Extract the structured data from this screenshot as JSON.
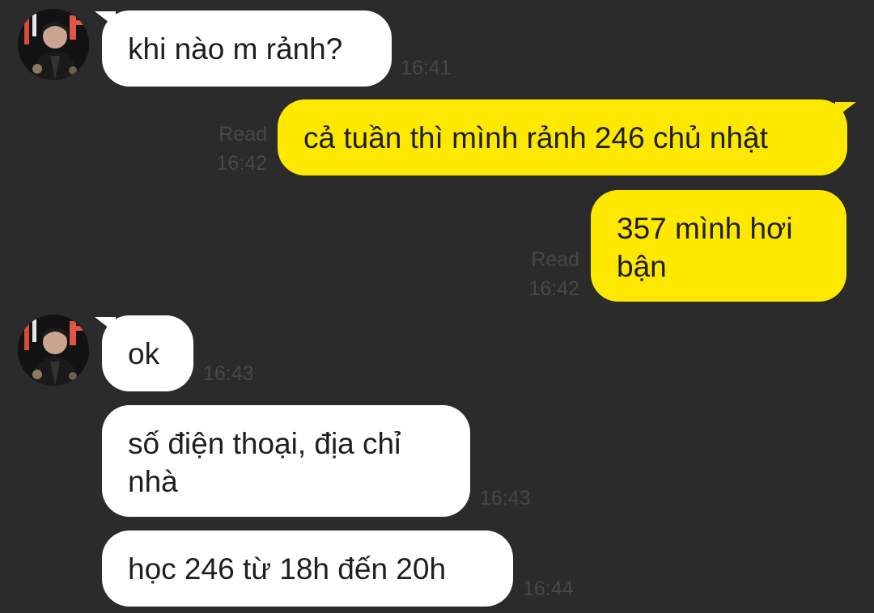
{
  "contact": {
    "avatar_icon": "contact-avatar-photo"
  },
  "messages": [
    {
      "direction": "incoming",
      "text": "khi nào m rảnh?",
      "time": "16:41"
    },
    {
      "direction": "outgoing",
      "text": "cả tuần thì mình rảnh 246 chủ nhật",
      "status": "Read",
      "time": "16:42"
    },
    {
      "direction": "outgoing",
      "text": "357 mình hơi bận",
      "status": "Read",
      "time": "16:42"
    },
    {
      "direction": "incoming",
      "text": "ok",
      "time": "16:43"
    },
    {
      "direction": "incoming",
      "text": "số điện thoại, địa chỉ nhà",
      "time": "16:43"
    },
    {
      "direction": "incoming",
      "text": "học 246 từ 18h đến 20h",
      "time": "16:44"
    }
  ],
  "colors": {
    "background": "#2b2b2b",
    "incoming_bubble": "#ffffff",
    "outgoing_bubble": "#fde800",
    "meta_text": "#484848"
  }
}
